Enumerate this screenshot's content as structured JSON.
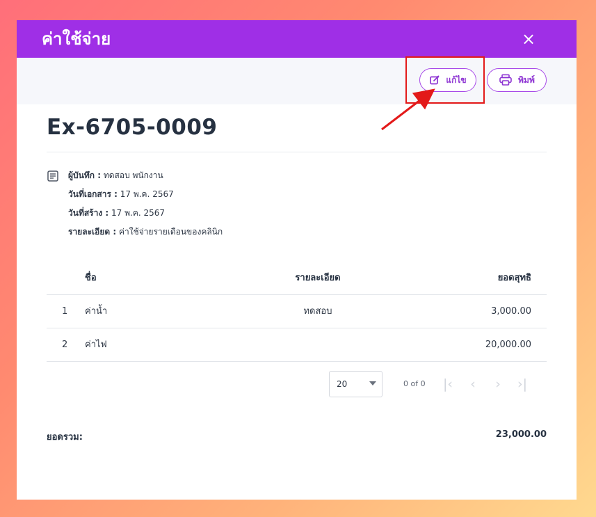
{
  "dialog": {
    "title": "ค่าใช้จ่าย",
    "close_symbol": "×"
  },
  "toolbar": {
    "edit_label": "แก้ไข",
    "print_label": "พิมพ์"
  },
  "document": {
    "number": "Ex-6705-0009",
    "meta": [
      {
        "label": "ผู้บันทึก :",
        "value": "ทดสอบ พนักงาน"
      },
      {
        "label": "วันที่เอกสาร :",
        "value": "17 พ.ค. 2567"
      },
      {
        "label": "วันที่สร้าง :",
        "value": "17 พ.ค. 2567"
      },
      {
        "label": "รายละเอียด :",
        "value": "ค่าใช้จ่ายรายเดือนของคลินิก"
      }
    ]
  },
  "table": {
    "headers": {
      "name": "ชื่อ",
      "detail": "รายละเอียด",
      "total": "ยอดสุทธิ"
    },
    "rows": [
      {
        "index": "1",
        "name": "ค่าน้ำ",
        "detail": "ทดสอบ",
        "total": "3,000.00"
      },
      {
        "index": "2",
        "name": "ค่าไฟ",
        "detail": "",
        "total": "20,000.00"
      }
    ]
  },
  "pagination": {
    "page_size": "20",
    "page_count": "0 of 0"
  },
  "summary": {
    "label": "ยอดรวม:",
    "value": "23,000.00"
  },
  "icons": {
    "close": "close-icon",
    "edit": "edit-icon",
    "print": "printer-icon",
    "meta": "document-icon",
    "first": "first-page-icon",
    "previous": "previous-page-icon",
    "next": "next-page-icon",
    "last": "last-page-icon"
  },
  "colors": {
    "header_purple": "#9f2fe6",
    "accent_purple": "#8e35d3",
    "highlight_red": "#e31919",
    "text_dark": "#263141"
  }
}
